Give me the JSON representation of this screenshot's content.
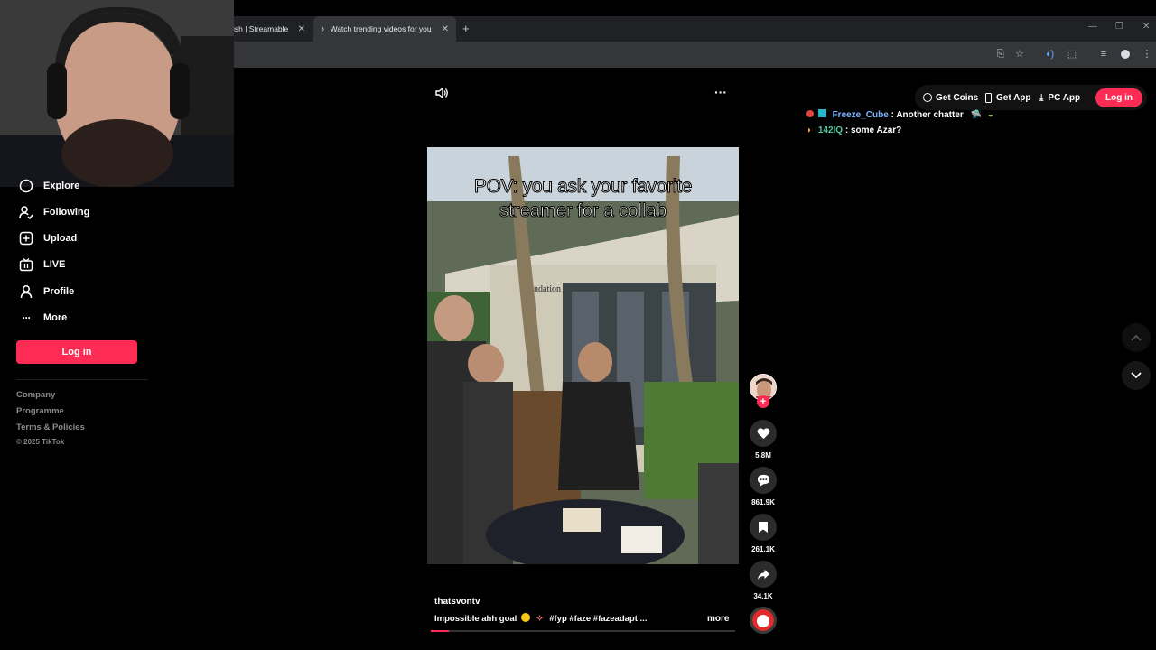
{
  "browser": {
    "tabs": [
      {
        "label": "ish | Streamable",
        "active": false
      },
      {
        "label": "Watch trending videos for you |",
        "active": true
      }
    ],
    "new_tab_icon": "plus-icon",
    "window_controls": [
      "minimize-icon",
      "restore-icon",
      "close-icon"
    ]
  },
  "sidebar": {
    "items": [
      {
        "label": "Explore",
        "icon": "compass-icon"
      },
      {
        "label": "Following",
        "icon": "following-icon"
      },
      {
        "label": "Upload",
        "icon": "upload-icon"
      },
      {
        "label": "LIVE",
        "icon": "live-icon"
      },
      {
        "label": "Profile",
        "icon": "profile-icon"
      },
      {
        "label": "More",
        "icon": "more-icon"
      }
    ],
    "login_label": "Log in",
    "footer": [
      "Company",
      "Programme",
      "Terms & Policies"
    ],
    "copyright": "© 2025 TikTok"
  },
  "header": {
    "get_coins": "Get Coins",
    "get_app": "Get App",
    "pc_app": "PC App",
    "login_label": "Log in",
    "accent": "#fe2c55"
  },
  "chat": [
    {
      "user": "Freeze_Cube",
      "message": ": Another chatter",
      "user_color": "#7db4ff"
    },
    {
      "user": "142IQ",
      "message": ": some Azar?",
      "user_color": "#4ec9a0"
    }
  ],
  "video": {
    "caption_line1": "POV: you ask your favorite",
    "caption_line2": "streamer for a collab",
    "sign_text": "ndation",
    "author": "thatsvontv",
    "description": "Impossible ahh goal",
    "hashtags": "#fyp  #faze  #fazeadapt  ...",
    "more_label": "more",
    "progress": 0.06
  },
  "actions": {
    "likes": "5.8M",
    "comments": "861.9K",
    "saves": "261.1K",
    "shares": "34.1K"
  }
}
